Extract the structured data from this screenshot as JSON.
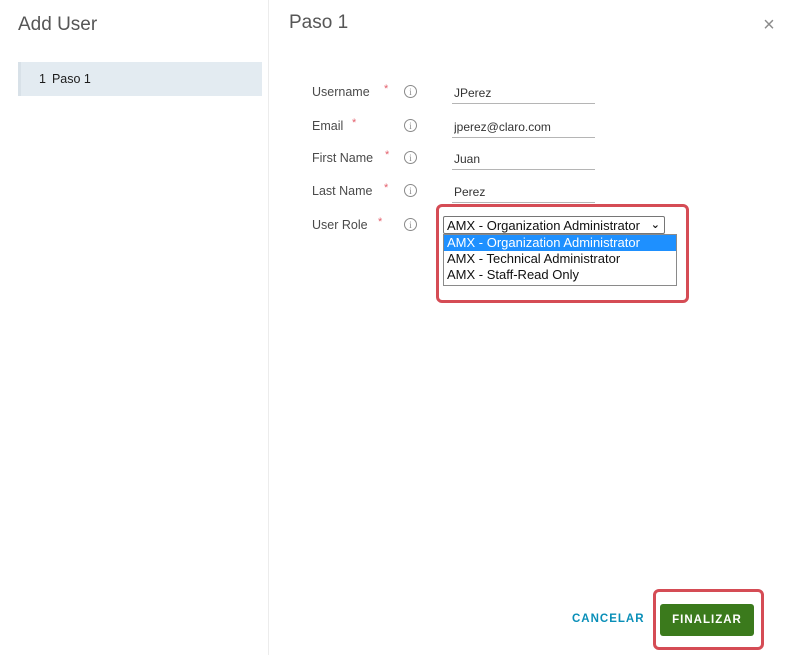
{
  "wizard": {
    "title": "Add User",
    "steps": [
      {
        "number": "1",
        "label": "Paso 1"
      }
    ]
  },
  "step": {
    "title": "Paso 1",
    "close_glyph": "×"
  },
  "form": {
    "required_mark": "*",
    "info_glyph": "i",
    "fields": {
      "username": {
        "label": "Username",
        "value": "JPerez"
      },
      "email": {
        "label": "Email",
        "value": "jperez@claro.com"
      },
      "first_name": {
        "label": "First Name",
        "value": "Juan"
      },
      "last_name": {
        "label": "Last Name",
        "value": "Perez"
      },
      "user_role": {
        "label": "User Role",
        "selected": "AMX - Organization Administrator",
        "options": [
          "AMX - Organization Administrator",
          "AMX - Technical Administrator",
          "AMX - Staff-Read Only"
        ]
      }
    }
  },
  "footer": {
    "cancel_label": "CANCELAR",
    "finish_label": "FINALIZAR"
  },
  "colors": {
    "accent_green": "#3b7a1c",
    "link_blue": "#0a8fb8",
    "highlight_red": "#d54c55",
    "selected_option": "#1e90ff"
  },
  "icons": {
    "close": "close-icon",
    "info": "info-icon",
    "select_chevron": "chevron-down-icon"
  }
}
